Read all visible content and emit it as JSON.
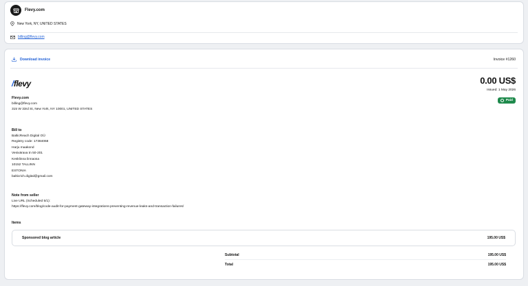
{
  "seller": {
    "name": "Flevy.com",
    "location": "New York, NY, UNITED STATES",
    "email": "billing@flevy.com"
  },
  "invoice": {
    "download_label": "Download invoice",
    "number": "Invoice #1260",
    "brand_logo_text": "flevy",
    "amount": "0.00 US$",
    "issued": "Issued: 1 May 2026",
    "status": "Paid",
    "status_color": "#1f8a4c",
    "accent_color": "#1f5fd6"
  },
  "seller_info": {
    "name": "Flevy.com",
    "email": "billing@flevy.com",
    "address": "315 W 33rd St, New York, NY 10001, UNITED STATES"
  },
  "bill_to": {
    "heading": "Bill to",
    "lines": [
      "BalticReach Digital OÜ",
      "Registry code: 17384068",
      "Harju maakond",
      "Vesivärava tn 50-201",
      "Kesklinna linnaosa",
      "10152 TALLINN",
      "ESTONIA",
      "balticrich.digital@gmail.com"
    ]
  },
  "note": {
    "heading": "Note from seller",
    "lines": [
      "Live URL (Scheduled 5/1):",
      "https://flevy.com/blog/code-audit-for-payment-gateway-integrations-preventing-revenue-leaks-and-transaction-failures/"
    ]
  },
  "items": {
    "heading": "Items",
    "rows": [
      {
        "name": "Sponsored blog article",
        "price": "195.00 US$"
      }
    ]
  },
  "totals": {
    "subtotal_label": "Subtotal",
    "subtotal_value": "195.00 US$",
    "total_label": "Total",
    "total_value": "195.00 US$"
  }
}
